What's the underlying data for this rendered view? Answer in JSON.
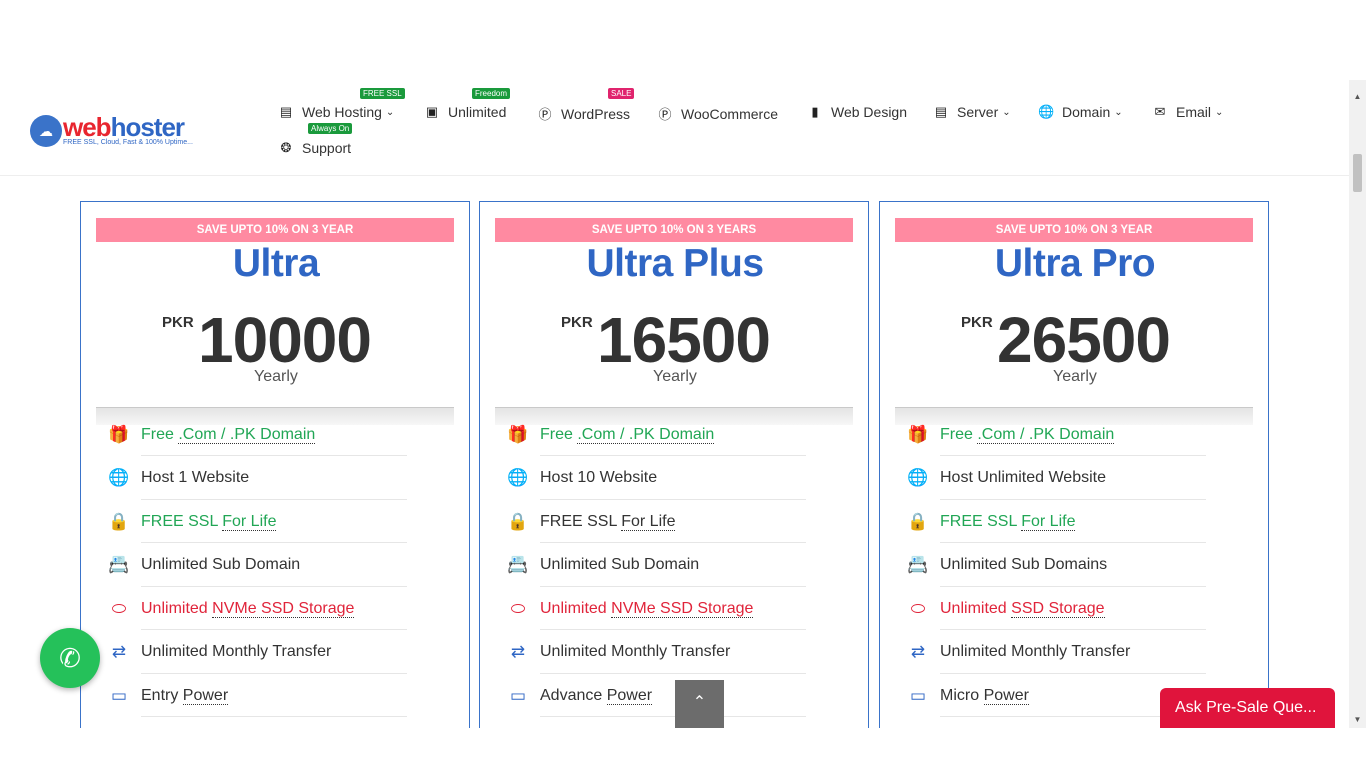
{
  "header": {
    "logo": {
      "brand_a": "web",
      "brand_b": "hoster",
      "tagline": "FREE SSL, Cloud, Fast & 100% Uptime..."
    },
    "nav": [
      {
        "label": "Web Hosting",
        "icon": "server-icon",
        "dropdown": true,
        "badge": "FREE SSL",
        "badge_color": "#1a9a3c"
      },
      {
        "label": "Unlimited",
        "icon": "briefcase-icon",
        "dropdown": false,
        "badge": "Freedom",
        "badge_color": "#1a9a3c"
      },
      {
        "label": "WordPress",
        "icon": "wordpress-icon",
        "dropdown": false,
        "badge": "SALE",
        "badge_color": "#e0246d"
      },
      {
        "label": "WooCommerce",
        "icon": "wordpress-icon",
        "dropdown": false
      },
      {
        "label": "Web Design",
        "icon": "desktop-icon",
        "dropdown": false
      },
      {
        "label": "Server",
        "icon": "server-icon",
        "dropdown": true
      },
      {
        "label": "Domain",
        "icon": "globe-icon",
        "dropdown": true
      },
      {
        "label": "Email",
        "icon": "envelope-icon",
        "dropdown": true
      },
      {
        "label": "Support",
        "icon": "lifering-icon",
        "dropdown": false,
        "badge": "Always On",
        "badge_color": "#1a9a3c"
      }
    ]
  },
  "plans": [
    {
      "ribbon": "SAVE UPTO 10% ON 3 YEAR",
      "name": "Ultra",
      "currency": "PKR",
      "price": "10000",
      "period": "Yearly",
      "features": [
        {
          "pre": "Free ",
          "link": ".Com / .PK Domain",
          "style": "green",
          "icon": "gift-icon"
        },
        {
          "pre": "Host 1 Website",
          "link": "",
          "style": "normal",
          "icon": "globe-icon"
        },
        {
          "pre": "FREE SSL ",
          "link": "For Life",
          "style": "green",
          "icon": "lock-icon"
        },
        {
          "pre": "Unlimited Sub Domain",
          "link": "",
          "style": "normal",
          "icon": "address-book-icon"
        },
        {
          "pre": "Unlimited ",
          "link": "NVMe SSD Storage",
          "style": "red",
          "icon": "hdd-icon"
        },
        {
          "pre": "Unlimited Monthly Transfer",
          "link": "",
          "style": "normal",
          "icon": "exchange-icon"
        },
        {
          "pre": "Entry ",
          "link": "Power",
          "style": "normal",
          "icon": "battery-icon"
        }
      ]
    },
    {
      "ribbon": "SAVE UPTO 10% ON 3 YEARS",
      "name": "Ultra Plus",
      "currency": "PKR",
      "price": "16500",
      "period": "Yearly",
      "features": [
        {
          "pre": "Free ",
          "link": ".Com / .PK Domain",
          "style": "green",
          "icon": "gift-icon"
        },
        {
          "pre": "Host 10 Website",
          "link": "",
          "style": "normal",
          "icon": "globe-icon"
        },
        {
          "pre": "FREE SSL ",
          "link": "For Life",
          "style": "normal",
          "icon": "lock-icon"
        },
        {
          "pre": "Unlimited Sub Domain",
          "link": "",
          "style": "normal",
          "icon": "address-book-icon"
        },
        {
          "pre": "Unlimited ",
          "link": "NVMe SSD Storage",
          "style": "red",
          "icon": "hdd-icon"
        },
        {
          "pre": "Unlimited Monthly Transfer",
          "link": "",
          "style": "normal",
          "icon": "exchange-icon"
        },
        {
          "pre": "Advance ",
          "link": "Power",
          "style": "normal",
          "icon": "battery-icon"
        }
      ]
    },
    {
      "ribbon": "SAVE UPTO 10% ON 3 YEAR",
      "name": "Ultra Pro",
      "currency": "PKR",
      "price": "26500",
      "period": "Yearly",
      "features": [
        {
          "pre": "Free ",
          "link": ".Com / .PK Domain",
          "style": "green",
          "icon": "gift-icon"
        },
        {
          "pre": "Host Unlimited Website",
          "link": "",
          "style": "normal",
          "icon": "globe-icon"
        },
        {
          "pre": "FREE SSL ",
          "link": "For Life",
          "style": "green",
          "icon": "lock-icon"
        },
        {
          "pre": "Unlimited Sub Domains",
          "link": "",
          "style": "normal",
          "icon": "address-book-icon"
        },
        {
          "pre": "Unlimited ",
          "link": "SSD Storage",
          "style": "red",
          "icon": "hdd-icon"
        },
        {
          "pre": "Unlimited Monthly Transfer",
          "link": "",
          "style": "normal",
          "icon": "exchange-icon"
        },
        {
          "pre": "Micro ",
          "link": "Power",
          "style": "normal",
          "icon": "battery-icon"
        }
      ]
    }
  ],
  "floating": {
    "presale_label": "Ask Pre-Sale Que...",
    "whatsapp_icon": "whatsapp-icon",
    "to_top_icon": "chevron-up-icon"
  }
}
